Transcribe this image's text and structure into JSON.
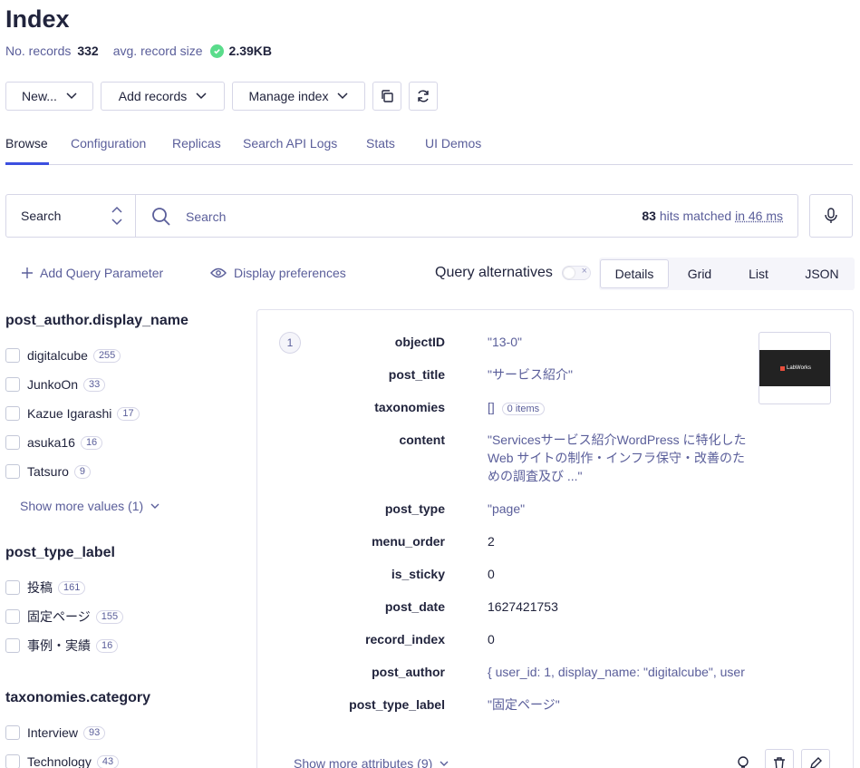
{
  "page": {
    "title": "Index"
  },
  "stats": {
    "records_label": "No. records",
    "records_value": "332",
    "size_label": "avg. record size",
    "size_value": "2.39KB"
  },
  "toolbar": {
    "new_label": "New...",
    "add_records_label": "Add records",
    "manage_index_label": "Manage index"
  },
  "tabs": [
    "Browse",
    "Configuration",
    "Replicas",
    "Search API Logs",
    "Stats",
    "UI Demos"
  ],
  "search": {
    "mode": "Search",
    "placeholder": "Search",
    "hits_count": "83",
    "hits_text": "hits matched",
    "time": "in 46 ms"
  },
  "query_bar": {
    "add_param": "Add Query Parameter",
    "display_prefs": "Display preferences",
    "alternatives": "Query alternatives",
    "views": [
      "Details",
      "Grid",
      "List",
      "JSON"
    ]
  },
  "facets": [
    {
      "title": "post_author.display_name",
      "items": [
        {
          "label": "digitalcube",
          "count": "255"
        },
        {
          "label": "JunkoOn",
          "count": "33"
        },
        {
          "label": "Kazue Igarashi",
          "count": "17"
        },
        {
          "label": "asuka16",
          "count": "16"
        },
        {
          "label": "Tatsuro",
          "count": "9"
        }
      ],
      "show_more": "Show more values (1)"
    },
    {
      "title": "post_type_label",
      "items": [
        {
          "label": "投稿",
          "count": "161"
        },
        {
          "label": "固定ページ",
          "count": "155"
        },
        {
          "label": "事例・実績",
          "count": "16"
        }
      ]
    },
    {
      "title": "taxonomies.category",
      "items": [
        {
          "label": "Interview",
          "count": "93"
        },
        {
          "label": "Technology",
          "count": "43"
        }
      ]
    }
  ],
  "record": {
    "rank": "1",
    "thumb_text": "LabWorks",
    "attrs": [
      {
        "key": "objectID",
        "value": "\"13-0\""
      },
      {
        "key": "post_title",
        "value": "\"サービス紹介\""
      },
      {
        "key": "taxonomies",
        "value": "[]",
        "badge": "0 items"
      },
      {
        "key": "content",
        "value": "\"Servicesサービス紹介WordPress に特化した Web サイトの制作・インフラ保守・改善のための調査及び ...\""
      },
      {
        "key": "post_type",
        "value": "\"page\""
      },
      {
        "key": "menu_order",
        "value": "2"
      },
      {
        "key": "is_sticky",
        "value": "0"
      },
      {
        "key": "post_date",
        "value": "1627421753"
      },
      {
        "key": "record_index",
        "value": "0"
      },
      {
        "key": "post_author",
        "value": "{ user_id: 1, display_name: \"digitalcube\", user"
      },
      {
        "key": "post_type_label",
        "value": "\"固定ページ\""
      }
    ],
    "show_more": "Show more attributes (9)"
  }
}
